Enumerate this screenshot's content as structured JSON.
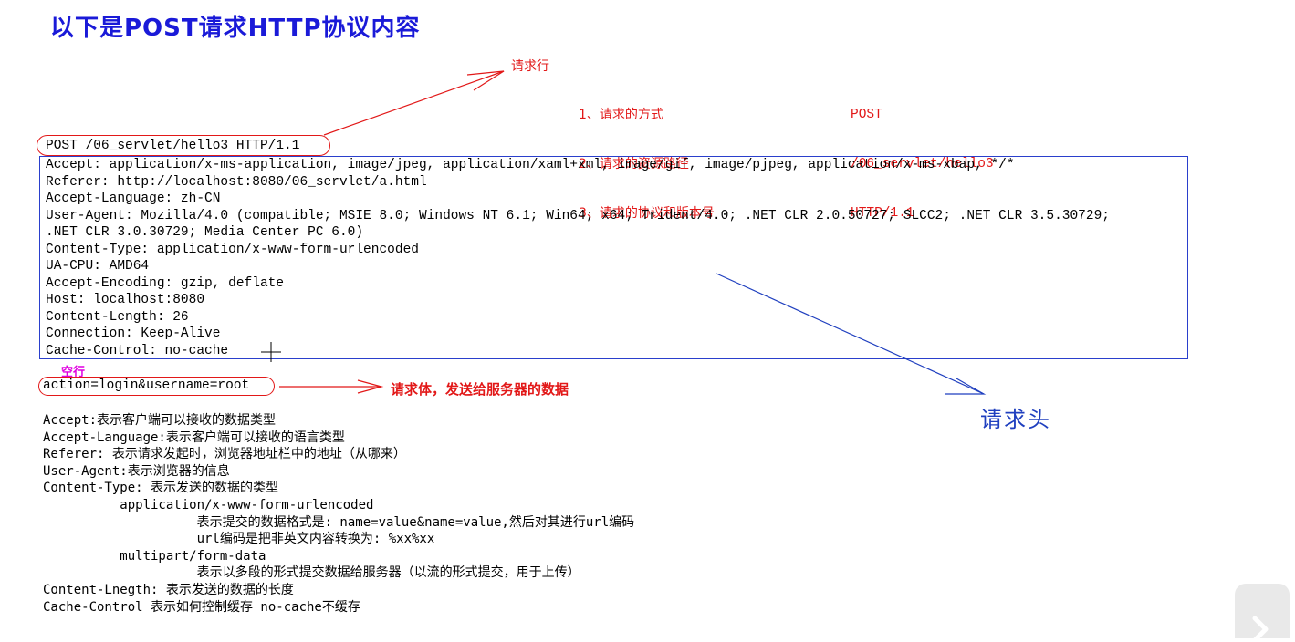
{
  "title": "以下是POST请求HTTP协议内容",
  "request_line": {
    "label": "请求行",
    "text": "POST /06_servlet/hello3 HTTP/1.1",
    "parts": [
      {
        "name": "1、请求的方式",
        "value": "POST"
      },
      {
        "name": "2、请求的资源路径",
        "value": "/06_servlet/hello3"
      },
      {
        "name": "3、请求的协议和版本号",
        "value": "HTTP/1.1"
      }
    ]
  },
  "headers": [
    "Accept: application/x-ms-application, image/jpeg, application/xaml+xml, image/gif, image/pjpeg, application/x-ms-xbap, */*",
    "Referer: http://localhost:8080/06_servlet/a.html",
    "Accept-Language: zh-CN",
    "User-Agent: Mozilla/4.0 (compatible; MSIE 8.0; Windows NT 6.1; Win64; x64; Trident/4.0; .NET CLR 2.0.50727; SLCC2; .NET CLR 3.5.30729;",
    ".NET CLR 3.0.30729; Media Center PC 6.0)",
    "Content-Type: application/x-www-form-urlencoded",
    "UA-CPU: AMD64",
    "Accept-Encoding: gzip, deflate",
    "Host: localhost:8080",
    "Content-Length: 26",
    "Connection: Keep-Alive",
    "Cache-Control: no-cache"
  ],
  "headers_label": "请求头",
  "blank_line_label": "空行",
  "body": {
    "text": "action=login&username=root",
    "label": "请求体，发送给服务器的数据"
  },
  "notes": [
    "Accept:表示客户端可以接收的数据类型",
    "Accept-Language:表示客户端可以接收的语言类型",
    "Referer: 表示请求发起时，浏览器地址栏中的地址（从哪来）",
    "User-Agent:表示浏览器的信息",
    "Content-Type: 表示发送的数据的类型",
    "          application/x-www-form-urlencoded",
    "                    表示提交的数据格式是: name=value&name=value,然后对其进行url编码",
    "                    url编码是把非英文内容转换为: %xx%xx",
    "          multipart/form-data",
    "                    表示以多段的形式提交数据给服务器（以流的形式提交，用于上传）",
    "Content-Lnegth: 表示发送的数据的长度",
    "Cache-Control 表示如何控制缓存 no-cache不缓存"
  ],
  "colors": {
    "title": "#1a1ad8",
    "annotation_red": "#e21818",
    "header_box_blue": "#2a3fcc",
    "blank_magenta": "#e000e0"
  },
  "icons": [
    "play-icon",
    "crosshair-cursor-icon"
  ]
}
